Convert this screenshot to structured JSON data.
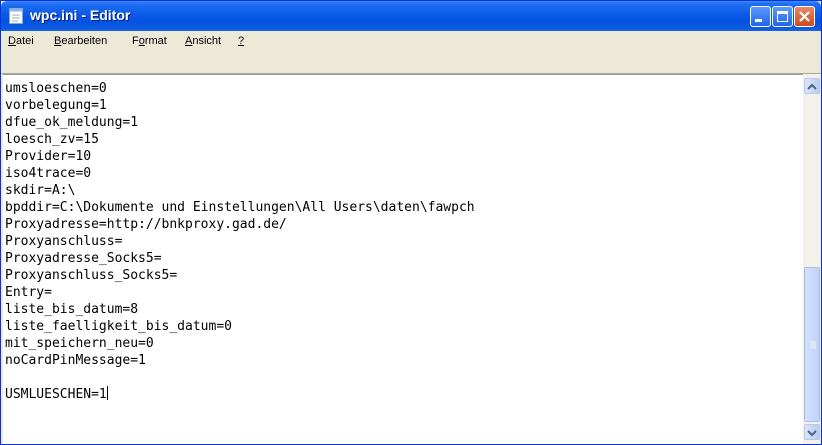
{
  "window": {
    "title": "wpc.ini - Editor",
    "colors": {
      "titlebar": "#0a5ae8",
      "close_button": "#cf4a22",
      "menubar": "#ece9d8"
    }
  },
  "menu": {
    "items": [
      {
        "label": "Datei",
        "mnemonic": "D"
      },
      {
        "label": "Bearbeiten",
        "mnemonic": "B"
      },
      {
        "label": "Format",
        "mnemonic": "o"
      },
      {
        "label": "Ansicht",
        "mnemonic": "A"
      },
      {
        "label": "?",
        "mnemonic": "?"
      }
    ]
  },
  "editor": {
    "lines": [
      "umsloeschen=0",
      "vorbelegung=1",
      "dfue_ok_meldung=1",
      "loesch_zv=15",
      "Provider=10",
      "iso4trace=0",
      "skdir=A:\\",
      "bpddir=C:\\Dokumente und Einstellungen\\All Users\\daten\\fawpch",
      "Proxyadresse=http://bnkproxy.gad.de/",
      "Proxyanschluss=",
      "Proxyadresse_Socks5=",
      "Proxyanschluss_Socks5=",
      "Entry=",
      "liste_bis_datum=8",
      "liste_faelligkeit_bis_datum=0",
      "mit_speichern_neu=0",
      "noCardPinMessage=1",
      "",
      "USMLUESCHEN=1"
    ]
  },
  "icons": {
    "app": "notepad-icon",
    "minimize": "minimize-icon",
    "maximize": "maximize-icon",
    "close": "close-icon",
    "scroll_up": "arrow-up-icon",
    "scroll_down": "arrow-down-icon"
  }
}
